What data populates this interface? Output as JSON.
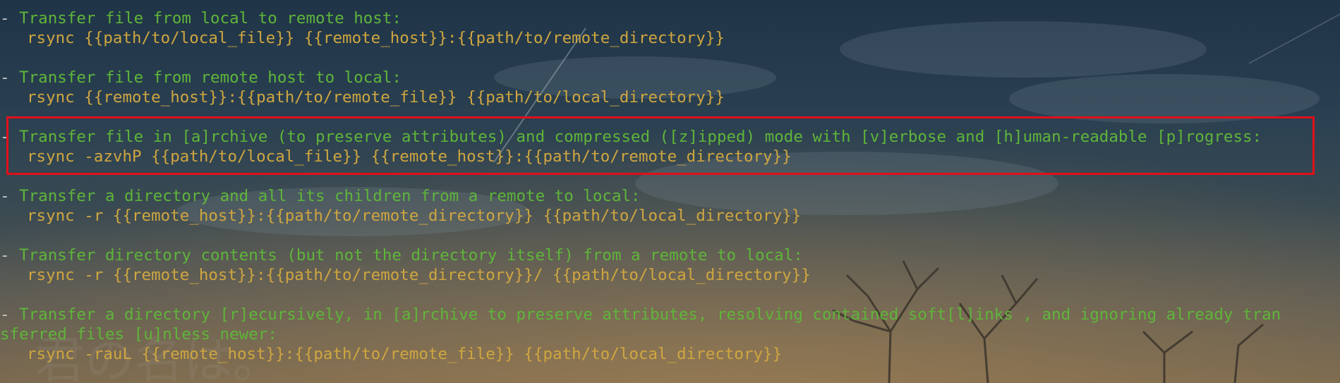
{
  "entries": [
    {
      "description": "Transfer file from local to remote host:",
      "command": "rsync {{path/to/local_file}} {{remote_host}}:{{path/to/remote_directory}}"
    },
    {
      "description": "Transfer file from remote host to local:",
      "command": "rsync {{remote_host}}:{{path/to/remote_file}} {{path/to/local_directory}}"
    },
    {
      "description": "Transfer file in [a]rchive (to preserve attributes) and compressed ([z]ipped) mode with [v]erbose and [h]uman-readable [p]rogress:",
      "command": "rsync -azvhP {{path/to/local_file}} {{remote_host}}:{{path/to/remote_directory}}"
    },
    {
      "description": "Transfer a directory and all its children from a remote to local:",
      "command": "rsync -r {{remote_host}}:{{path/to/remote_directory}} {{path/to/local_directory}}"
    },
    {
      "description": "Transfer directory contents (but not the directory itself) from a remote to local:",
      "command": "rsync -r {{remote_host}}:{{path/to/remote_directory}}/ {{path/to/local_directory}}"
    },
    {
      "description": "Transfer a directory [r]ecursively, in [a]rchive to preserve attributes, resolving contained soft[l]inks , and ignoring already tran",
      "description_wrap": "sferred files [u]nless newer:",
      "command": "rsync -rauL {{remote_host}}:{{path/to/remote_file}} {{path/to/local_directory}}"
    }
  ],
  "dash": "-",
  "highlighted_entry_index": 2,
  "colors": {
    "description": "#5fb53a",
    "command": "#cfa640",
    "highlight_border": "#e0101a"
  }
}
